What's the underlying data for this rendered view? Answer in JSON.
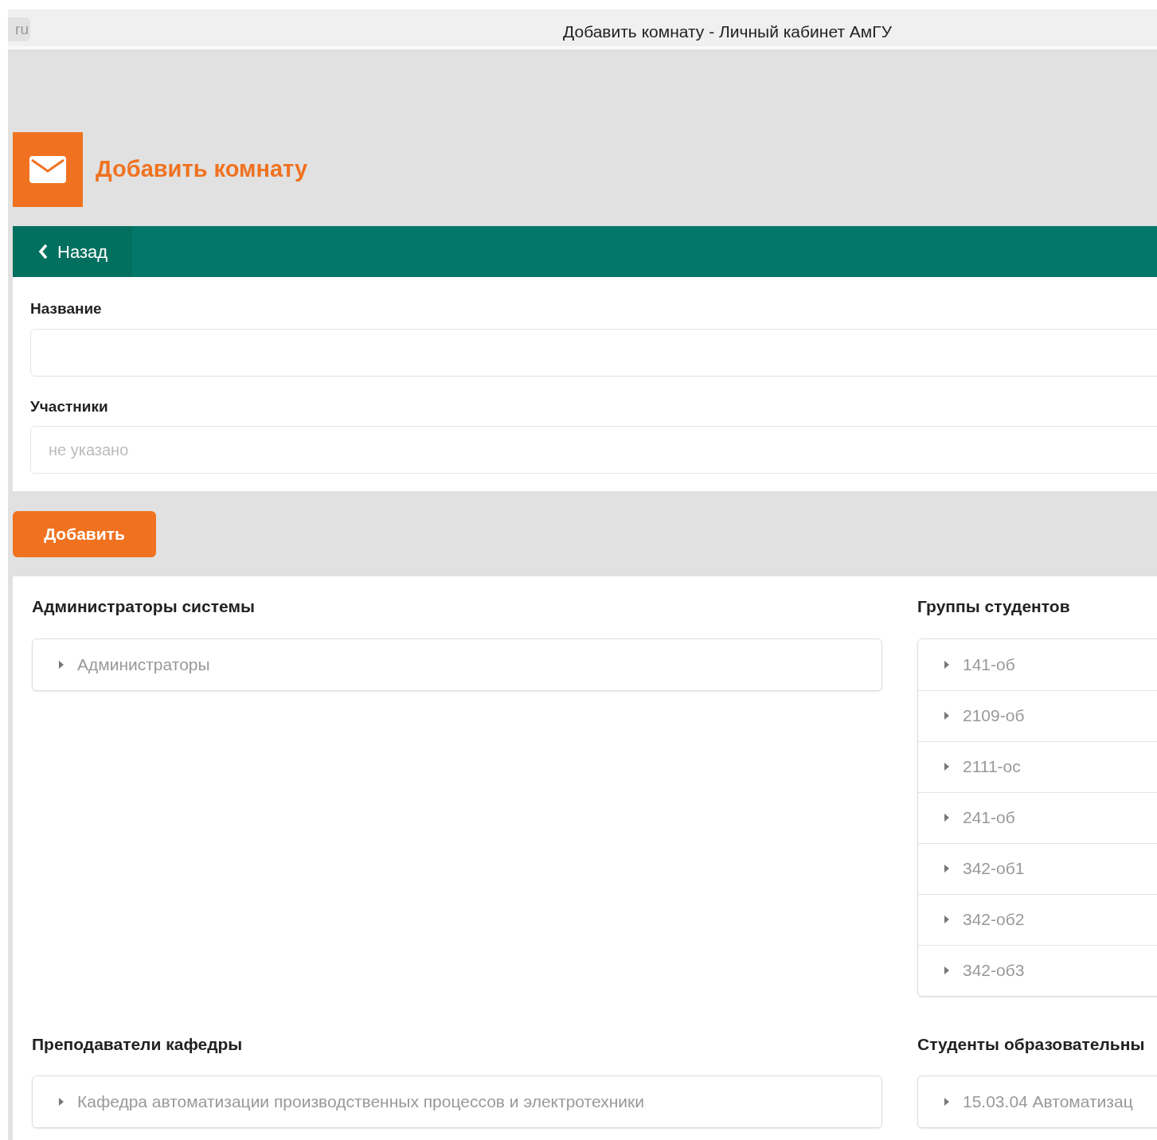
{
  "browser": {
    "tab_label": "ru",
    "title": "Добавить комнату - Личный кабинет АмГУ"
  },
  "page_title": "Добавить комнату",
  "back_button": "Назад",
  "form": {
    "fields": [
      {
        "label": "Название"
      },
      {
        "label": "Участники",
        "placeholder": "не указано"
      }
    ]
  },
  "submit_button": "Добавить",
  "sections": [
    {
      "title": "Администраторы системы",
      "items": [
        {
          "label": "Администраторы",
          "expanded": false
        }
      ]
    },
    {
      "title": "Группы студентов",
      "items": [
        {
          "label": "141-об",
          "expanded": false
        },
        {
          "label": "2109-об",
          "expanded": false
        },
        {
          "label": "2111-ос",
          "expanded": false
        },
        {
          "label": "241-об",
          "expanded": false
        },
        {
          "label": "342-об1",
          "expanded": false
        },
        {
          "label": "342-об2",
          "expanded": false
        },
        {
          "label": "342-об3",
          "expanded": false
        }
      ]
    },
    {
      "title": "Преподаватели кафедры",
      "items": [
        {
          "label": "Кафедра автоматизации производственных процессов и электротехники",
          "expanded": false
        }
      ]
    },
    {
      "title": "Студенты образовательны",
      "items": [
        {
          "label": "15.03.04 Автоматизац",
          "expanded": false
        }
      ]
    }
  ]
}
